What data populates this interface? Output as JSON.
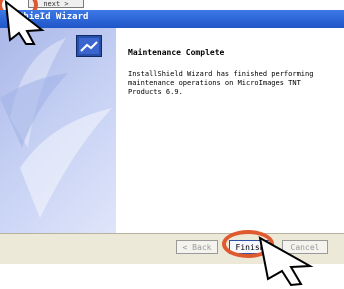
{
  "top_strip": {
    "button_label": "next >"
  },
  "dialog": {
    "title": "ShieId Wizard",
    "heading": "Maintenance Complete",
    "message": "InstallShield Wizard has finished performing maintenance operations on MicroImages TNT Products 6.9."
  },
  "buttons": {
    "back": "< Back",
    "finish": "Finish",
    "cancel": "Cancel"
  },
  "colors": {
    "highlight": "#e05a2f",
    "titlebar": "#1f55c8"
  }
}
